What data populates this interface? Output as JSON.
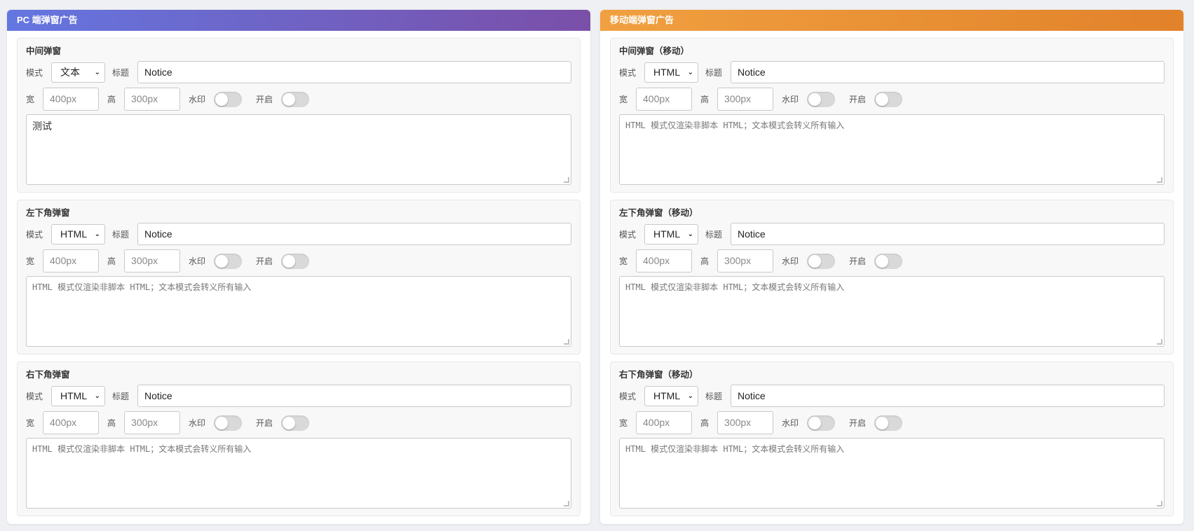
{
  "panels": [
    {
      "id": "pc",
      "title": "PC 端弹窗广告",
      "blocks": [
        {
          "title": "中间弹窗",
          "mode_label": "模式",
          "mode": "文本",
          "title_label": "标题",
          "title_value": "Notice",
          "width_label": "宽",
          "width_placeholder": "400px",
          "height_label": "高",
          "height_placeholder": "300px",
          "watermark_label": "水印",
          "enable_label": "开启",
          "content": "测试",
          "placeholder": ""
        },
        {
          "title": "左下角弹窗",
          "mode_label": "模式",
          "mode": "HTML",
          "title_label": "标题",
          "title_value": "Notice",
          "width_label": "宽",
          "width_placeholder": "400px",
          "height_label": "高",
          "height_placeholder": "300px",
          "watermark_label": "水印",
          "enable_label": "开启",
          "content": "",
          "placeholder": "HTML 模式仅渲染非脚本 HTML；文本模式会转义所有输入"
        },
        {
          "title": "右下角弹窗",
          "mode_label": "模式",
          "mode": "HTML",
          "title_label": "标题",
          "title_value": "Notice",
          "width_label": "宽",
          "width_placeholder": "400px",
          "height_label": "高",
          "height_placeholder": "300px",
          "watermark_label": "水印",
          "enable_label": "开启",
          "content": "",
          "placeholder": "HTML 模式仅渲染非脚本 HTML；文本模式会转义所有输入"
        }
      ]
    },
    {
      "id": "mobile",
      "title": "移动端弹窗广告",
      "blocks": [
        {
          "title": "中间弹窗（移动）",
          "mode_label": "模式",
          "mode": "HTML",
          "title_label": "标题",
          "title_value": "Notice",
          "width_label": "宽",
          "width_placeholder": "400px",
          "height_label": "高",
          "height_placeholder": "300px",
          "watermark_label": "水印",
          "enable_label": "开启",
          "content": "",
          "placeholder": "HTML 模式仅渲染非脚本 HTML；文本模式会转义所有输入"
        },
        {
          "title": "左下角弹窗（移动）",
          "mode_label": "模式",
          "mode": "HTML",
          "title_label": "标题",
          "title_value": "Notice",
          "width_label": "宽",
          "width_placeholder": "400px",
          "height_label": "高",
          "height_placeholder": "300px",
          "watermark_label": "水印",
          "enable_label": "开启",
          "content": "",
          "placeholder": "HTML 模式仅渲染非脚本 HTML；文本模式会转义所有输入"
        },
        {
          "title": "右下角弹窗（移动）",
          "mode_label": "模式",
          "mode": "HTML",
          "title_label": "标题",
          "title_value": "Notice",
          "width_label": "宽",
          "width_placeholder": "400px",
          "height_label": "高",
          "height_placeholder": "300px",
          "watermark_label": "水印",
          "enable_label": "开启",
          "content": "",
          "placeholder": "HTML 模式仅渲染非脚本 HTML；文本模式会转义所有输入"
        }
      ]
    }
  ],
  "toggles": {
    "watermark_on": false,
    "enable_on": false
  },
  "colors": {
    "pc_header_start": "#6476e0",
    "pc_header_end": "#7a4fa8",
    "mobile_header_start": "#f0a040",
    "mobile_header_end": "#e2822a",
    "toggle_off": "#d9d9d9"
  }
}
